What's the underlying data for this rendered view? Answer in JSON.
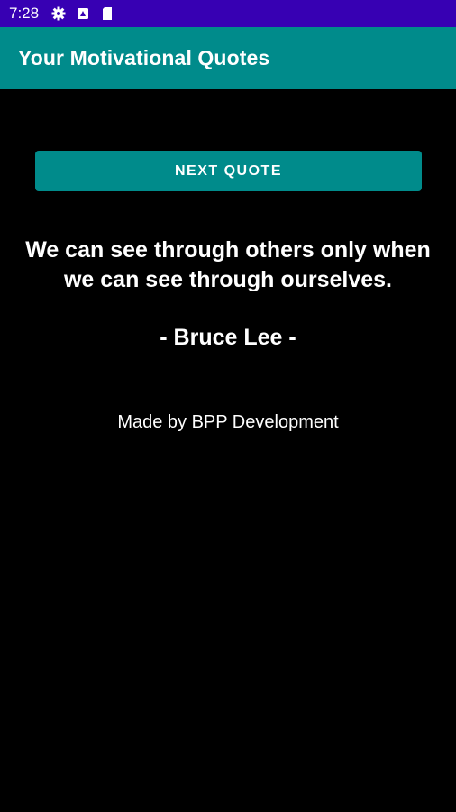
{
  "status_bar": {
    "time": "7:28",
    "icons": [
      "settings-icon",
      "notification-icon",
      "sd-card-icon"
    ],
    "background": "#3700b3"
  },
  "app_bar": {
    "title": "Your Motivational Quotes",
    "background": "#008b8b"
  },
  "main": {
    "next_button_label": "NEXT QUOTE",
    "quote": "We can see through others only when we can see through ourselves.",
    "author": "- Bruce Lee -",
    "credit": "Made by BPP Development"
  },
  "colors": {
    "accent": "#008b8b",
    "background": "#000000",
    "text": "#ffffff"
  }
}
